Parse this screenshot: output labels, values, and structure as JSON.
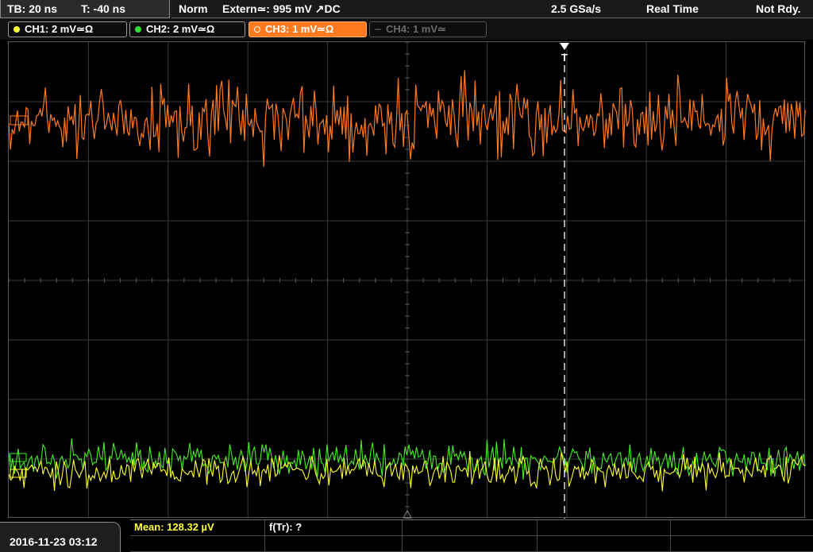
{
  "header": {
    "timebase": "TB: 20 ns",
    "trigger_time": "T: -40 ns",
    "trigger_mode": "Norm",
    "trigger_source": "Extern≃: 995 mV ↗DC",
    "sample_rate": "2.5 GSa/s",
    "acq_mode": "Real Time",
    "status": "Not Rdy."
  },
  "channels": [
    {
      "label": "CH1: 2 mV≃Ω",
      "color": "#ffff33",
      "state": "on"
    },
    {
      "label": "CH2: 2 mV≃Ω",
      "color": "#33dd33",
      "state": "on"
    },
    {
      "label": "CH3: 1 mV≃Ω",
      "color": "#ff7a1c",
      "state": "active"
    },
    {
      "label": "CH4: 1 mV≃",
      "color": "#555555",
      "state": "off"
    }
  ],
  "trigger_marker_label": "T",
  "measurements": {
    "mean": "Mean: 128.32 µV",
    "ftr": "f(Tr): ?"
  },
  "datetime": "2016-11-23 03:12",
  "colors": {
    "ch1": "#ffff33",
    "ch2": "#44ee22",
    "ch3": "#ff7a1c",
    "grid": "#3a3a3a",
    "trigger_line": "#ffffff"
  }
}
